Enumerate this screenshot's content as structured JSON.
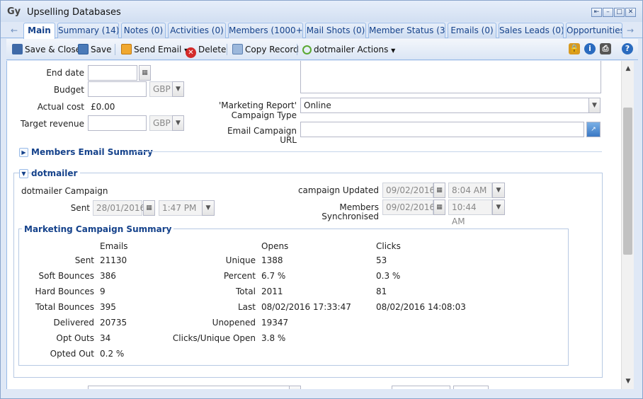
{
  "window": {
    "title": "Upselling Databases",
    "app_icon": "Gy"
  },
  "tabs": [
    {
      "label": "Main",
      "active": true
    },
    {
      "label": "Summary (14)"
    },
    {
      "label": "Notes (0)"
    },
    {
      "label": "Activities (0)"
    },
    {
      "label": "Members (1000+)"
    },
    {
      "label": "Mail Shots (0)"
    },
    {
      "label": "Member Status (3)"
    },
    {
      "label": "Emails (0)"
    },
    {
      "label": "Sales Leads (0)"
    },
    {
      "label": "Opportunities ("
    }
  ],
  "toolbar": {
    "save_close": "Save & Close",
    "save": "Save",
    "send_email": "Send Email",
    "delete": "Delete",
    "copy_record": "Copy Record",
    "dotmailer_actions": "dotmailer Actions"
  },
  "form": {
    "end_date_label": "End date",
    "end_date_value": "",
    "budget_label": "Budget",
    "budget_value": "",
    "budget_currency": "GBP",
    "actual_cost_label": "Actual cost",
    "actual_cost_value": "£0.00",
    "target_revenue_label": "Target revenue",
    "target_revenue_value": "",
    "target_currency": "GBP",
    "marketing_report_label_1": "'Marketing Report'",
    "marketing_report_label_2": "Campaign Type",
    "marketing_report_value": "Online",
    "email_campaign_label_1": "Email Campaign",
    "email_campaign_label_2": "URL",
    "email_campaign_value": ""
  },
  "sections": {
    "members_email_summary": "Members Email Summary",
    "dotmailer": "dotmailer"
  },
  "dotmailer": {
    "campaign_label": "dotmailer Campaign",
    "sent_label": "Sent",
    "sent_date": "28/01/2016",
    "sent_time": "1:47 PM",
    "updated_label": "campaign Updated",
    "updated_date": "09/02/2016",
    "updated_time": "8:04 AM",
    "members_sync_label_1": "Members",
    "members_sync_label_2": "Synchronised",
    "members_sync_date": "09/02/2016",
    "members_sync_time": "10:44 AM"
  },
  "summary": {
    "title": "Marketing Campaign Summary",
    "emails_header": "Emails",
    "opens_header": "Opens",
    "clicks_header": "Clicks",
    "emails": [
      {
        "label": "Sent",
        "value": "21130"
      },
      {
        "label": "Soft Bounces",
        "value": "386"
      },
      {
        "label": "Hard Bounces",
        "value": "9"
      },
      {
        "label": "Total Bounces",
        "value": "395"
      },
      {
        "label": "Delivered",
        "value": "20735"
      },
      {
        "label": "Opt Outs",
        "value": "34"
      },
      {
        "label": "Opted Out",
        "value": "0.2 %"
      }
    ],
    "opens": [
      {
        "label": "Unique",
        "value": "1388",
        "click": "53"
      },
      {
        "label": "Percent",
        "value": "6.7 %",
        "click": "0.3 %"
      },
      {
        "label": "Total",
        "value": "2011",
        "click": "81"
      },
      {
        "label": "Last",
        "value": "08/02/2016 17:33:47",
        "click": "08/02/2016 14:08:03"
      },
      {
        "label": "Unopened",
        "value": "19347",
        "click": ""
      },
      {
        "label": "Clicks/Unique Open",
        "value": "3.8 %",
        "click": ""
      }
    ]
  }
}
